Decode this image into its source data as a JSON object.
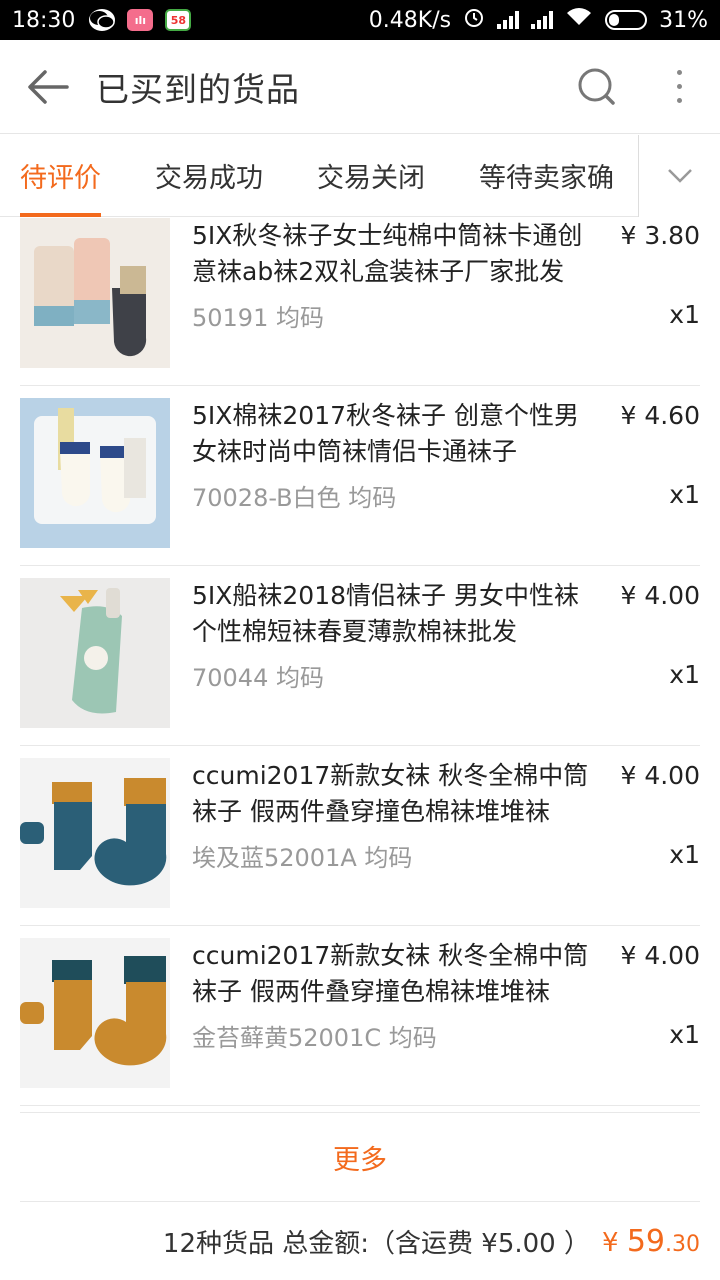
{
  "status_bar": {
    "time": "18:30",
    "network_speed": "0.48K/s",
    "battery": "31%"
  },
  "header": {
    "title": "已买到的货品"
  },
  "tabs": [
    {
      "label": "待评价",
      "active": true
    },
    {
      "label": "交易成功",
      "active": false
    },
    {
      "label": "交易关闭",
      "active": false
    },
    {
      "label": "等待卖家确",
      "active": false
    }
  ],
  "items": [
    {
      "name": "5IX秋冬袜子女士纯棉中筒袜卡通创意袜ab袜2双礼盒装袜子厂家批发",
      "price": "¥ 3.80",
      "spec": "50191 均码",
      "qty": "x1"
    },
    {
      "name": "5IX棉袜2017秋冬袜子 创意个性男女袜时尚中筒袜情侣卡通袜子",
      "price": "¥ 4.60",
      "spec": "70028-B白色 均码",
      "qty": "x1"
    },
    {
      "name": "5IX船袜2018情侣袜子 男女中性袜个性棉短袜春夏薄款棉袜批发",
      "price": "¥ 4.00",
      "spec": "70044 均码",
      "qty": "x1"
    },
    {
      "name": "ccumi2017新款女袜 秋冬全棉中筒袜子 假两件叠穿撞色棉袜堆堆袜",
      "price": "¥ 4.00",
      "spec": "埃及蓝52001A 均码",
      "qty": "x1"
    },
    {
      "name": "ccumi2017新款女袜 秋冬全棉中筒袜子 假两件叠穿撞色棉袜堆堆袜",
      "price": "¥ 4.00",
      "spec": "金苔藓黄52001C 均码",
      "qty": "x1"
    }
  ],
  "more_label": "更多",
  "summary": {
    "text": "12种货品 总金额:（含运费 ¥5.00 ）",
    "currency": "¥",
    "amount_int": "59",
    "amount_dec": ".30"
  },
  "colors": {
    "accent": "#f36a1d"
  }
}
